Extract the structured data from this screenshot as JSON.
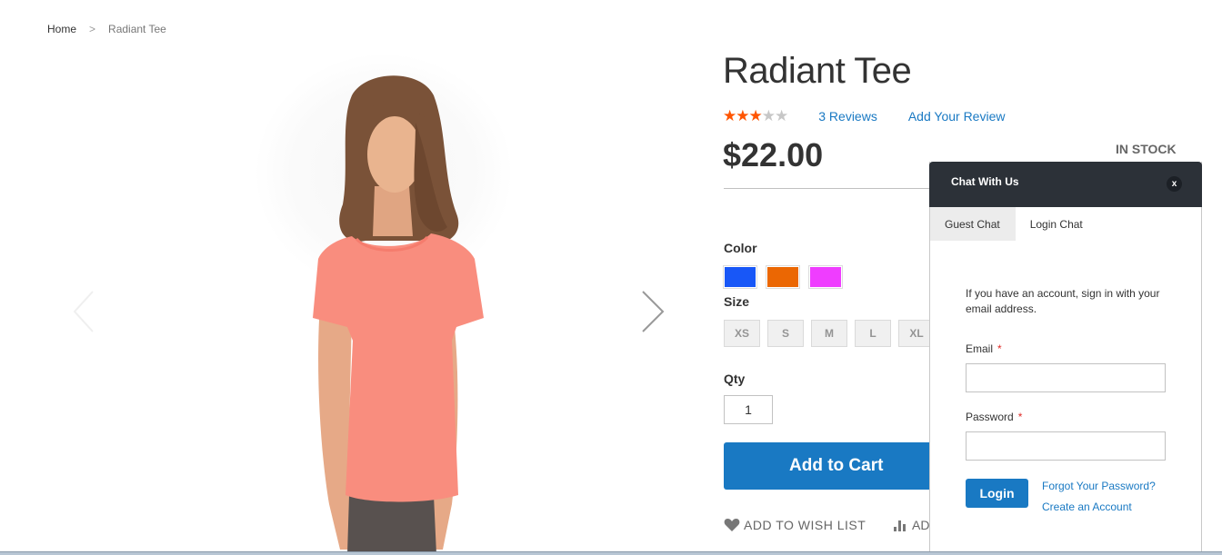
{
  "breadcrumb": {
    "home": "Home",
    "separator": ">",
    "current": "Radiant Tee"
  },
  "gallery": {
    "prev_icon": "chevron-left-icon",
    "next_icon": "chevron-right-icon",
    "image_alt": "Woman wearing coral Radiant Tee"
  },
  "product": {
    "title": "Radiant Tee",
    "rating": {
      "value": 3,
      "max": 5,
      "on_color": "#ff5501",
      "off_color": "#c7c7c7"
    },
    "reviews_link": "3 Reviews",
    "add_review_link": "Add Your Review",
    "price": "$22.00",
    "stock": "IN STOCK",
    "color_label": "Color",
    "colors": [
      {
        "name": "Blue",
        "hex": "#1857f7"
      },
      {
        "name": "Orange",
        "hex": "#eb6703"
      },
      {
        "name": "Purple",
        "hex": "#ef3dff"
      }
    ],
    "size_label": "Size",
    "sizes": [
      "XS",
      "S",
      "M",
      "L",
      "XL"
    ],
    "qty_label": "Qty",
    "qty_value": "1",
    "add_to_cart": "Add to Cart",
    "wishlist": "ADD TO WISH LIST",
    "compare": "AD",
    "accent": "#1979c3"
  },
  "chat": {
    "title": "Chat With Us",
    "close": "x",
    "tabs": [
      {
        "label": "Guest Chat",
        "active": true
      },
      {
        "label": "Login Chat",
        "active": false
      }
    ],
    "intro": "If you have an account, sign in with your email address.",
    "email_label": "Email",
    "password_label": "Password",
    "required_mark": "*",
    "email_value": "",
    "password_value": "",
    "login_button": "Login",
    "forgot_link": "Forgot Your Password?",
    "create_link": "Create an Account",
    "header_color": "#2c3138"
  }
}
